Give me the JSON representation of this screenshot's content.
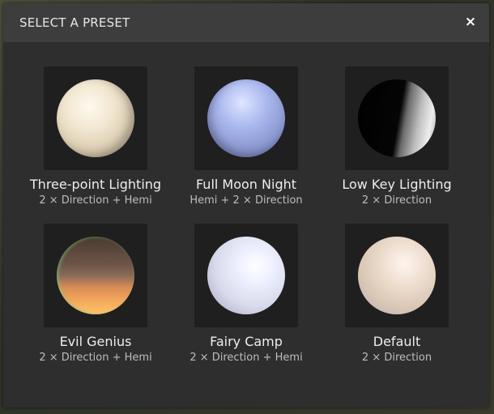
{
  "dialog": {
    "title": "SELECT A PRESET",
    "close_icon": "×"
  },
  "presets": [
    {
      "name": "Three-point Lighting",
      "description": "2 × Direction + Hemi"
    },
    {
      "name": "Full Moon Night",
      "description": "Hemi + 2 × Direction"
    },
    {
      "name": "Low Key Lighting",
      "description": "2 × Direction"
    },
    {
      "name": "Evil Genius",
      "description": "2 × Direction + Hemi"
    },
    {
      "name": "Fairy Camp",
      "description": "2 × Direction + Hemi"
    },
    {
      "name": "Default",
      "description": "2 × Direction"
    }
  ]
}
